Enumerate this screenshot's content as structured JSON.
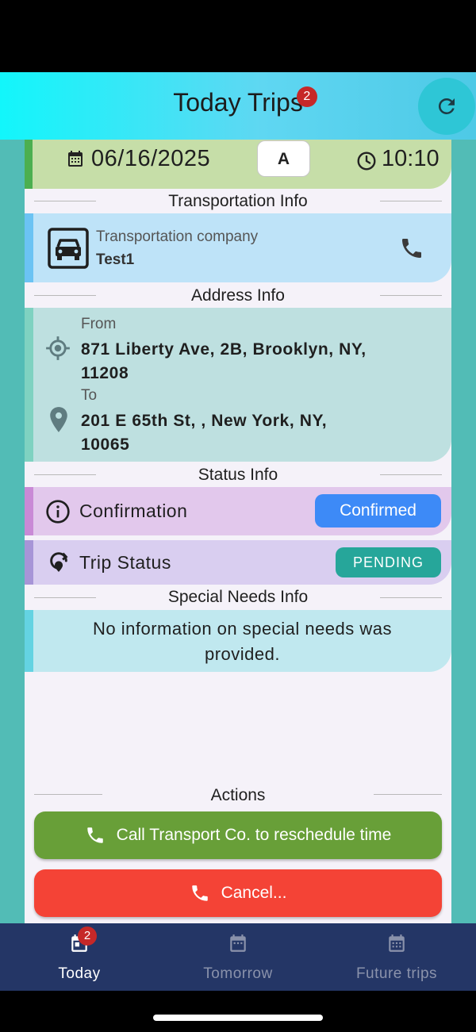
{
  "header": {
    "title": "Today Trips",
    "badge_count": "2",
    "refresh_icon": "refresh-icon"
  },
  "trip": {
    "date": "06/16/2025",
    "letter": "A",
    "time": "10:10"
  },
  "sections": {
    "transportation": "Transportation Info",
    "address": "Address Info",
    "status": "Status Info",
    "special_needs": "Special Needs Info",
    "actions": "Actions"
  },
  "transportation": {
    "label": "Transportation company",
    "company": "Test1"
  },
  "address": {
    "from_label": "From",
    "from_line1": "871 Liberty Ave, 2B, Brooklyn, NY,",
    "from_line2": "11208",
    "to_label": "To",
    "to_line1": "201 E 65th St, , New York, NY,",
    "to_line2": "10065"
  },
  "status": {
    "confirmation_label": "Confirmation",
    "confirmation_value": "Confirmed",
    "trip_status_label": "Trip Status",
    "trip_status_value": "PENDING"
  },
  "special_needs": {
    "line1": "No information on special needs was",
    "line2": "provided."
  },
  "actions": {
    "call_label": "Call Transport Co. to reschedule time",
    "cancel_label": "Cancel..."
  },
  "tabs": [
    {
      "label": "Today",
      "badge": "2",
      "active": true
    },
    {
      "label": "Tomorrow",
      "active": false
    },
    {
      "label": "Future trips",
      "active": false
    }
  ],
  "colors": {
    "header_gradient_start": "#12f6fb",
    "confirmed": "#3d8af7",
    "pending": "#26a69a",
    "call_button": "#689f38",
    "cancel_button": "#f44336",
    "tab_bar": "#243666"
  }
}
